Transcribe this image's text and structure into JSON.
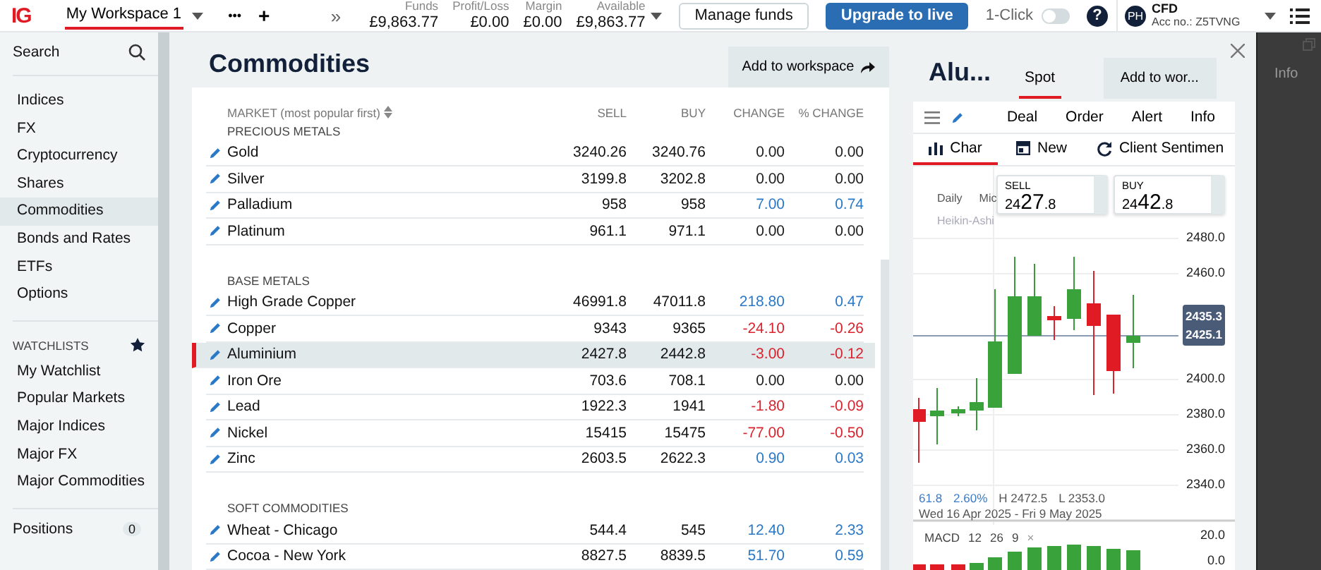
{
  "topbar": {
    "logo": "IG",
    "workspaces": [
      {
        "label": "My Workspace 1",
        "selected": true
      }
    ],
    "more": "•••",
    "add": "+",
    "expand": "»",
    "stats": [
      {
        "label": "Funds",
        "value": "£9,863.77"
      },
      {
        "label": "Profit/Loss",
        "value": "£0.00"
      },
      {
        "label": "Margin",
        "value": "£0.00"
      },
      {
        "label": "Available",
        "value": "£9,863.77"
      }
    ],
    "buttons": [
      {
        "label": "Manage funds",
        "kind": "secondary"
      },
      {
        "label": "Upgrade to live",
        "kind": "primary"
      }
    ],
    "one_click": {
      "label": "1-Click",
      "on": false
    },
    "help": "?",
    "account": {
      "initials": "PH",
      "type": "CFD",
      "number": "Acc no.: Z5TVNG"
    }
  },
  "sidebar": {
    "search": "Search",
    "items": [
      {
        "label": "Indices",
        "selected": false
      },
      {
        "label": "FX",
        "selected": false
      },
      {
        "label": "Cryptocurrency",
        "selected": false
      },
      {
        "label": "Shares",
        "selected": false
      },
      {
        "label": "Commodities",
        "selected": true
      },
      {
        "label": "Bonds and Rates",
        "selected": false
      },
      {
        "label": "ETFs",
        "selected": false
      },
      {
        "label": "Options",
        "selected": false
      }
    ],
    "watchlists_heading": "WATCHLISTS",
    "watchlists": [
      "My Watchlist",
      "Popular Markets",
      "Major Indices",
      "Major FX",
      "Major Commodities"
    ],
    "positions": {
      "label": "Positions",
      "count": "0"
    }
  },
  "main": {
    "title": "Commodities",
    "add_button": "Add to workspace",
    "table": {
      "columns": [
        "MARKET (most popular first)",
        "SELL",
        "BUY",
        "CHANGE",
        "% CHANGE"
      ],
      "groups": [
        {
          "name": "PRECIOUS METALS",
          "rows": [
            {
              "market": "Gold",
              "sell": "3240.26",
              "buy": "3240.76",
              "change": "0.00",
              "pct": "0.00",
              "color": "#222222",
              "selected": false
            },
            {
              "market": "Silver",
              "sell": "3199.8",
              "buy": "3202.8",
              "change": "0.00",
              "pct": "0.00",
              "color": "#222222",
              "selected": false
            },
            {
              "market": "Palladium",
              "sell": "958",
              "buy": "958",
              "change": "7.00",
              "pct": "0.74",
              "color": "#2a78c8",
              "selected": false
            },
            {
              "market": "Platinum",
              "sell": "961.1",
              "buy": "971.1",
              "change": "0.00",
              "pct": "0.00",
              "color": "#222222",
              "selected": false
            }
          ]
        },
        {
          "name": "BASE METALS",
          "rows": [
            {
              "market": "High Grade Copper",
              "sell": "46991.8",
              "buy": "47011.8",
              "change": "218.80",
              "pct": "0.47",
              "color": "#2a78c8",
              "selected": false
            },
            {
              "market": "Copper",
              "sell": "9343",
              "buy": "9365",
              "change": "-24.10",
              "pct": "-0.26",
              "color": "#d9232e",
              "selected": false
            },
            {
              "market": "Aluminium",
              "sell": "2427.8",
              "buy": "2442.8",
              "change": "-3.00",
              "pct": "-0.12",
              "color": "#d9232e",
              "selected": true
            },
            {
              "market": "Iron Ore",
              "sell": "703.6",
              "buy": "708.1",
              "change": "0.00",
              "pct": "0.00",
              "color": "#222222",
              "selected": false
            },
            {
              "market": "Lead",
              "sell": "1922.3",
              "buy": "1941",
              "change": "-1.80",
              "pct": "-0.09",
              "color": "#d9232e",
              "selected": false
            },
            {
              "market": "Nickel",
              "sell": "15415",
              "buy": "15475",
              "change": "-77.00",
              "pct": "-0.50",
              "color": "#d9232e",
              "selected": false
            },
            {
              "market": "Zinc",
              "sell": "2603.5",
              "buy": "2622.3",
              "change": "0.90",
              "pct": "0.03",
              "color": "#2a78c8",
              "selected": false
            }
          ]
        },
        {
          "name": "SOFT COMMODITIES",
          "rows": [
            {
              "market": "Wheat - Chicago",
              "sell": "544.4",
              "buy": "545",
              "change": "12.40",
              "pct": "2.33",
              "color": "#2a78c8",
              "selected": false
            },
            {
              "market": "Cocoa - New York",
              "sell": "8827.5",
              "buy": "8839.5",
              "change": "51.70",
              "pct": "0.59",
              "color": "#2a78c8",
              "selected": false
            }
          ]
        }
      ]
    }
  },
  "detail": {
    "title": "Alu...",
    "tabs": [
      {
        "label": "Spot",
        "selected": true
      }
    ],
    "add_button": "Add to wor...",
    "actions": [
      "Deal",
      "Order",
      "Alert",
      "Info"
    ],
    "subtabs": [
      {
        "label": "Char",
        "kind": "chart",
        "selected": true
      },
      {
        "label": "New",
        "kind": "news",
        "selected": false
      },
      {
        "label": "Client Sentimen",
        "kind": "sentiment",
        "selected": false
      }
    ],
    "chart_options": [
      "Daily",
      "Mic",
      "Heikin-Ashi"
    ],
    "sell": {
      "label": "SELL",
      "lead": "24",
      "big": "27",
      "tail": ".8"
    },
    "buy": {
      "label": "BUY",
      "lead": "24",
      "big": "42",
      "tail": ".8"
    },
    "y_ticks": [
      "2480.0",
      "2460.0",
      "2400.0",
      "2380.0",
      "2360.0",
      "2340.0"
    ],
    "price_tags": [
      "2435.3",
      "2425.1"
    ],
    "stats": [
      {
        "text": "61.8",
        "kind": "accent"
      },
      {
        "text": "2.60%",
        "kind": "accent"
      },
      {
        "text": "H 2472.5",
        "kind": "plain"
      },
      {
        "text": "L 2353.0",
        "kind": "plain"
      }
    ],
    "range": "Wed 16 Apr 2025 - Fri 9 May 2025",
    "macd": {
      "label": "MACD",
      "params": [
        "12",
        "26",
        "9"
      ],
      "close": "×",
      "ticks": [
        "20.0",
        "0.0"
      ]
    }
  },
  "side_panel": {
    "tab": "Info"
  }
}
